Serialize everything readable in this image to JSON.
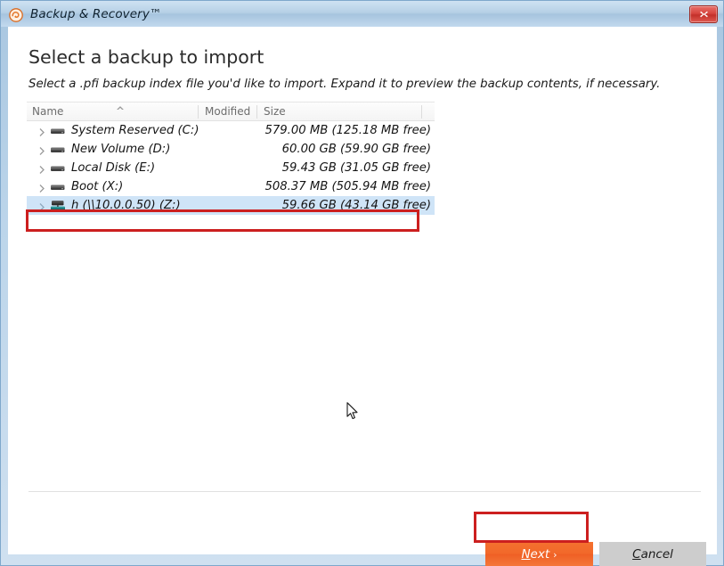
{
  "window": {
    "title": "Backup & Recovery™",
    "app_icon": "backup-recovery-logo-icon",
    "close_label": "✕"
  },
  "page": {
    "title": "Select a backup to import",
    "subtitle": "Select a .pfi backup index file you'd like to import. Expand it to preview the backup contents, if necessary."
  },
  "list": {
    "columns": [
      {
        "label": "Name"
      },
      {
        "label": "Modified"
      },
      {
        "label": "Size"
      }
    ],
    "sort_indicator": "sort-ascending-icon",
    "rows": [
      {
        "name": "System Reserved (C:)",
        "modified": "",
        "size": "579.00 MB (125.18 MB free)",
        "icon": "local-drive-icon",
        "selected": false
      },
      {
        "name": "New Volume (D:)",
        "modified": "",
        "size": "60.00 GB (59.90 GB free)",
        "icon": "local-drive-icon",
        "selected": false
      },
      {
        "name": "Local Disk (E:)",
        "modified": "",
        "size": "59.43 GB (31.05 GB free)",
        "icon": "local-drive-icon",
        "selected": false
      },
      {
        "name": "Boot (X:)",
        "modified": "",
        "size": "508.37 MB (505.94 MB free)",
        "icon": "local-drive-icon",
        "selected": false
      },
      {
        "name": "h (\\\\10.0.0.50) (Z:)",
        "modified": "",
        "size": "59.66 GB (43.14 GB free)",
        "icon": "network-drive-icon",
        "selected": true
      }
    ]
  },
  "footer": {
    "next_accel": "N",
    "next_rest": "ext",
    "next_chevron": "›",
    "cancel_accel": "C",
    "cancel_rest": "ancel"
  },
  "colors": {
    "accent_orange": "#f2682a",
    "annotation_red": "#cc1f1f",
    "selection_blue": "#cfe4f7",
    "titlebar_blue": "#b6d0e6",
    "close_red": "#d6453e"
  }
}
